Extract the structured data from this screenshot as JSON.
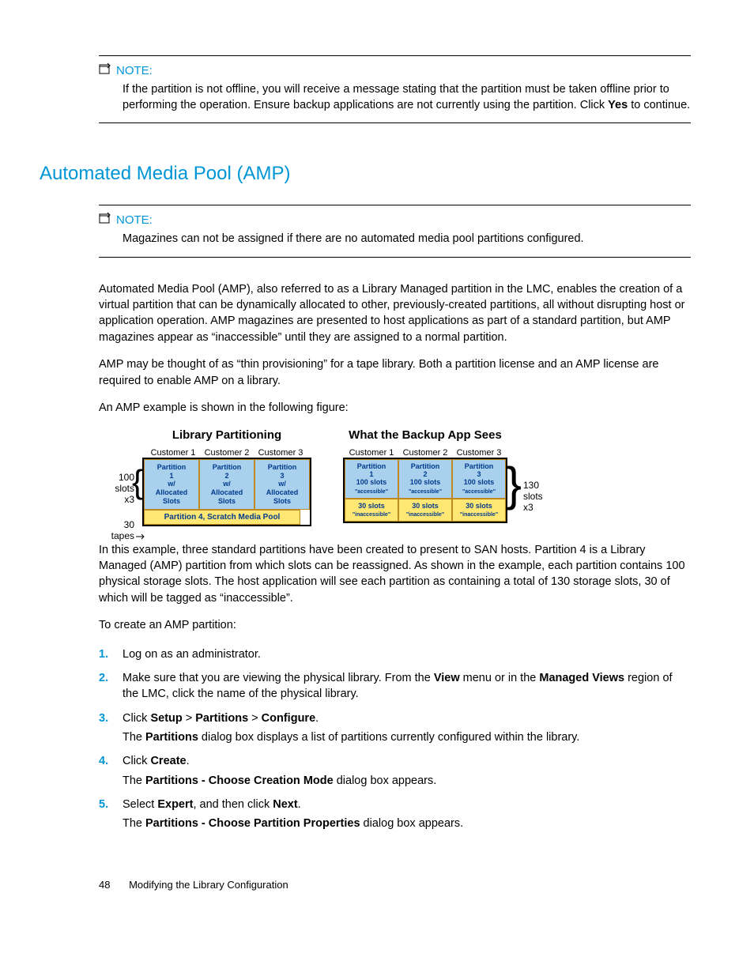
{
  "note1": {
    "label": "NOTE:",
    "text_pre": "If the partition is not offline, you will receive a message stating that the partition must be taken offline prior to performing the operation. Ensure backup applications are not currently using the partition. Click ",
    "text_bold": "Yes",
    "text_post": " to continue."
  },
  "heading": "Automated Media Pool (AMP)",
  "note2": {
    "label": "NOTE:",
    "text": "Magazines can not be assigned if there are no automated media pool partitions configured."
  },
  "para1": "Automated Media Pool (AMP), also referred to as a Library Managed partition in the LMC, enables the creation of a virtual partition that can be dynamically allocated to other, previously-created partitions, all without disrupting host or application operation. AMP magazines are presented to host applications as part of a standard partition, but AMP magazines appear as “inaccessible” until they are assigned to a normal partition.",
  "para2": "AMP may be thought of as “thin provisioning” for a tape library. Both a partition license and an AMP license are required to enable AMP on a library.",
  "para3": "An AMP example is shown in the following figure:",
  "diagram": {
    "left_title": "Library Partitioning",
    "right_title": "What the Backup App Sees",
    "customers": [
      "Customer 1",
      "Customer 2",
      "Customer 3"
    ],
    "left_label1": "100 slots x3",
    "left_label2": "30 tapes",
    "left_cells": [
      "Partition 1 w/ Allocated Slots",
      "Partition 2 w/ Allocated Slots",
      "Partition 3 w/ Allocated Slots"
    ],
    "left_yellow": "Partition 4, Scratch Media Pool",
    "right_cells_top": [
      {
        "a": "Partition 1",
        "b": "100 slots",
        "c": "\"accessible\""
      },
      {
        "a": "Partition 2",
        "b": "100 slots",
        "c": "\"accessible\""
      },
      {
        "a": "Partition 3",
        "b": "100 slots",
        "c": "\"accessible\""
      }
    ],
    "right_cells_bot": [
      {
        "a": "30 slots",
        "b": "\"inaccessible\""
      },
      {
        "a": "30 slots",
        "b": "\"inaccessible\""
      },
      {
        "a": "30 slots",
        "b": "\"inaccessible\""
      }
    ],
    "right_label": "130 slots x3"
  },
  "para4": "In this example, three standard partitions have been created to present to SAN hosts. Partition 4 is a Library Managed (AMP) partition from which slots can be reassigned. As shown in the example, each partition contains 100 physical storage slots. The host application will see each partition as containing a total of 130 storage slots, 30 of which will be tagged as “inaccessible”.",
  "para5": "To create an AMP partition:",
  "steps": {
    "s1": "Log on as an administrator.",
    "s2_a": "Make sure that you are viewing the physical library. From the ",
    "s2_b": "View",
    "s2_c": " menu or in the ",
    "s2_d": "Managed Views",
    "s2_e": " region of the LMC, click the name of the physical library.",
    "s3_a": "Click ",
    "s3_b": "Setup",
    "s3_c": "Partitions",
    "s3_d": "Configure",
    "s3_sub_a": "The ",
    "s3_sub_b": "Partitions",
    "s3_sub_c": " dialog box displays a list of partitions currently configured within the library.",
    "s4_a": "Click ",
    "s4_b": "Create",
    "s4_sub_a": "The ",
    "s4_sub_b": "Partitions - Choose Creation Mode",
    "s4_sub_c": " dialog box appears.",
    "s5_a": "Select ",
    "s5_b": "Expert",
    "s5_c": ", and then click ",
    "s5_d": "Next",
    "s5_sub_a": "The ",
    "s5_sub_b": "Partitions - Choose Partition Properties",
    "s5_sub_c": " dialog box appears."
  },
  "footer": {
    "page": "48",
    "title": "Modifying the Library Configuration"
  }
}
